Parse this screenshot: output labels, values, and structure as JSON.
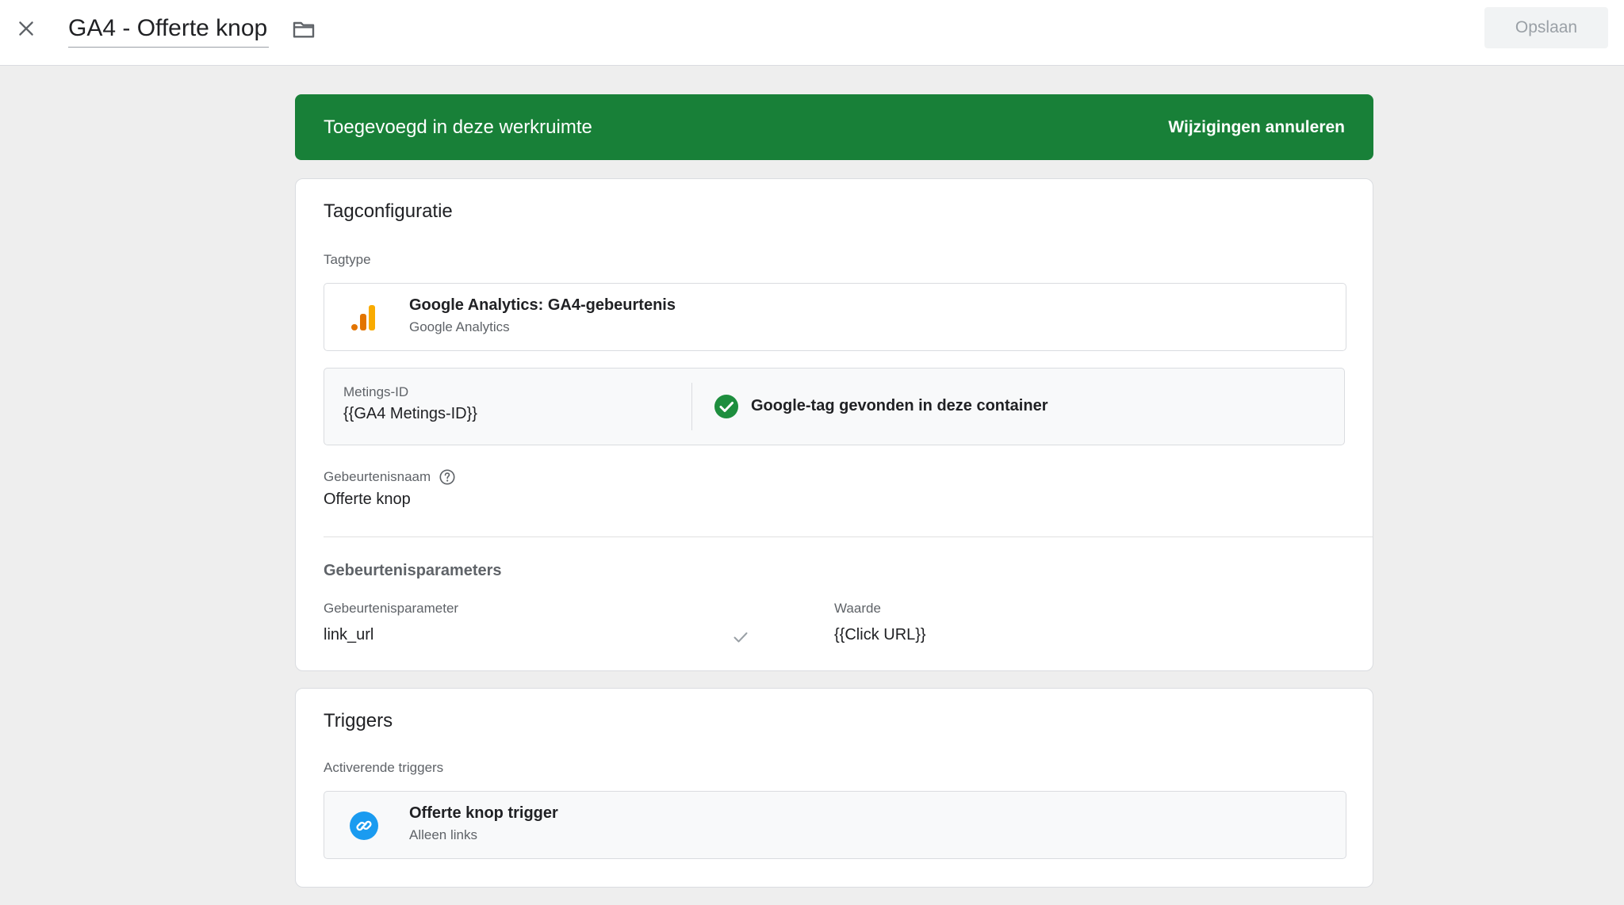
{
  "header": {
    "close_icon": "close-icon",
    "title": "GA4 - Offerte knop",
    "folder_icon": "folder-icon",
    "save_label": "Opslaan"
  },
  "banner": {
    "text": "Toegevoegd in deze werkruimte",
    "action_label": "Wijzigingen annuleren",
    "color": "#188038"
  },
  "tag_config": {
    "title": "Tagconfiguratie",
    "tag_type_label": "Tagtype",
    "tag_type": {
      "icon": "google-analytics-icon",
      "name": "Google Analytics: GA4-gebeurtenis",
      "vendor": "Google Analytics"
    },
    "measurement": {
      "label": "Metings-ID",
      "value": "{{GA4 Metings-ID}}",
      "status_icon": "check-circle-icon",
      "status_text": "Google-tag gevonden in deze container",
      "status_color": "#1e8e3e"
    },
    "event_name_label": "Gebeurtenisnaam",
    "event_name_help_icon": "help-icon",
    "event_name": "Offerte knop",
    "params_section_title": "Gebeurtenisparameters",
    "params_columns": {
      "param": "Gebeurtenisparameter",
      "value": "Waarde"
    },
    "params": [
      {
        "param": "link_url",
        "value": "{{Click URL}}"
      }
    ]
  },
  "triggers": {
    "title": "Triggers",
    "firing_label": "Activerende triggers",
    "items": [
      {
        "icon": "link-icon",
        "name": "Offerte knop trigger",
        "type": "Alleen links",
        "icon_color": "#1a9bf0"
      }
    ]
  }
}
